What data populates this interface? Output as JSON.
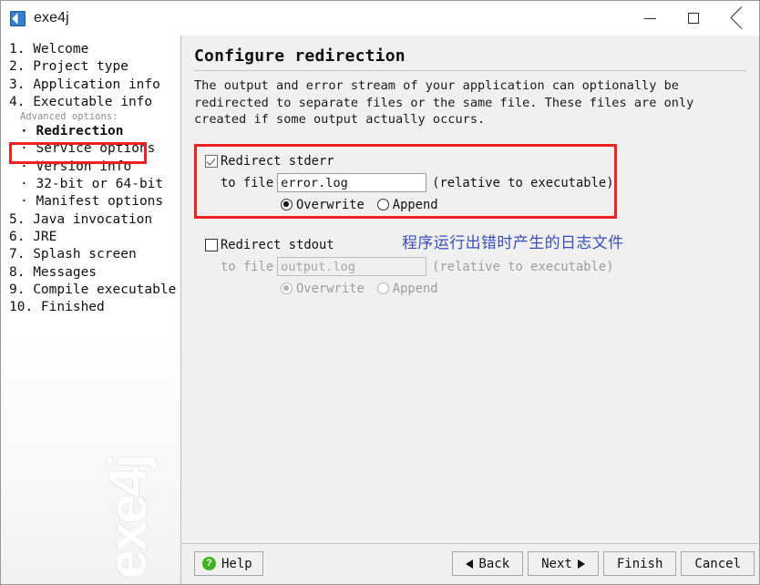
{
  "window": {
    "title": "exe4j",
    "icon": "exe4j-app-icon",
    "controls": {
      "minimize": "minimize-icon",
      "maximize": "maximize-icon",
      "close": "close-icon"
    }
  },
  "sidebar": {
    "watermark": "exe4j",
    "items": [
      {
        "num": "1.",
        "label": "Welcome",
        "type": "step"
      },
      {
        "num": "2.",
        "label": "Project type",
        "type": "step"
      },
      {
        "num": "3.",
        "label": "Application info",
        "type": "step"
      },
      {
        "num": "4.",
        "label": "Executable info",
        "type": "step"
      },
      {
        "num": "",
        "label": "Advanced options:",
        "type": "group"
      },
      {
        "num": "·",
        "label": "Redirection",
        "type": "sub",
        "current": true
      },
      {
        "num": "·",
        "label": "Service options",
        "type": "sub"
      },
      {
        "num": "·",
        "label": "Version info",
        "type": "sub"
      },
      {
        "num": "·",
        "label": "32-bit or 64-bit",
        "type": "sub"
      },
      {
        "num": "·",
        "label": "Manifest options",
        "type": "sub"
      },
      {
        "num": "5.",
        "label": "Java invocation",
        "type": "step"
      },
      {
        "num": "6.",
        "label": "JRE",
        "type": "step"
      },
      {
        "num": "7.",
        "label": "Splash screen",
        "type": "step"
      },
      {
        "num": "8.",
        "label": "Messages",
        "type": "step"
      },
      {
        "num": "9.",
        "label": "Compile executable",
        "type": "step"
      },
      {
        "num": "10.",
        "label": "Finished",
        "type": "step"
      }
    ]
  },
  "main": {
    "title": "Configure redirection",
    "description": "The output and error stream of your application can optionally be redirected to separate files or the same file. These files are only created if some output actually occurs.",
    "stderr": {
      "checkbox_label": "Redirect stderr",
      "checked": true,
      "to_file_label": "to file",
      "file_value": "error.log",
      "relative_hint": "(relative to executable)",
      "overwrite_label": "Overwrite",
      "append_label": "Append",
      "mode": "Overwrite"
    },
    "stdout": {
      "checkbox_label": "Redirect stdout",
      "checked": false,
      "to_file_label": "to file",
      "file_value": "output.log",
      "relative_hint": "(relative to executable)",
      "overwrite_label": "Overwrite",
      "append_label": "Append",
      "mode": "Overwrite"
    },
    "annotation": "程序运行出错时产生的日志文件"
  },
  "footer": {
    "help": "Help",
    "back": "Back",
    "next": "Next",
    "finish": "Finish",
    "cancel": "Cancel"
  },
  "colors": {
    "annotation_red": "#f02020",
    "annotation_blue": "#3a4fc4",
    "help_green": "#3cb521",
    "panel_bg": "#f0f0f0"
  }
}
